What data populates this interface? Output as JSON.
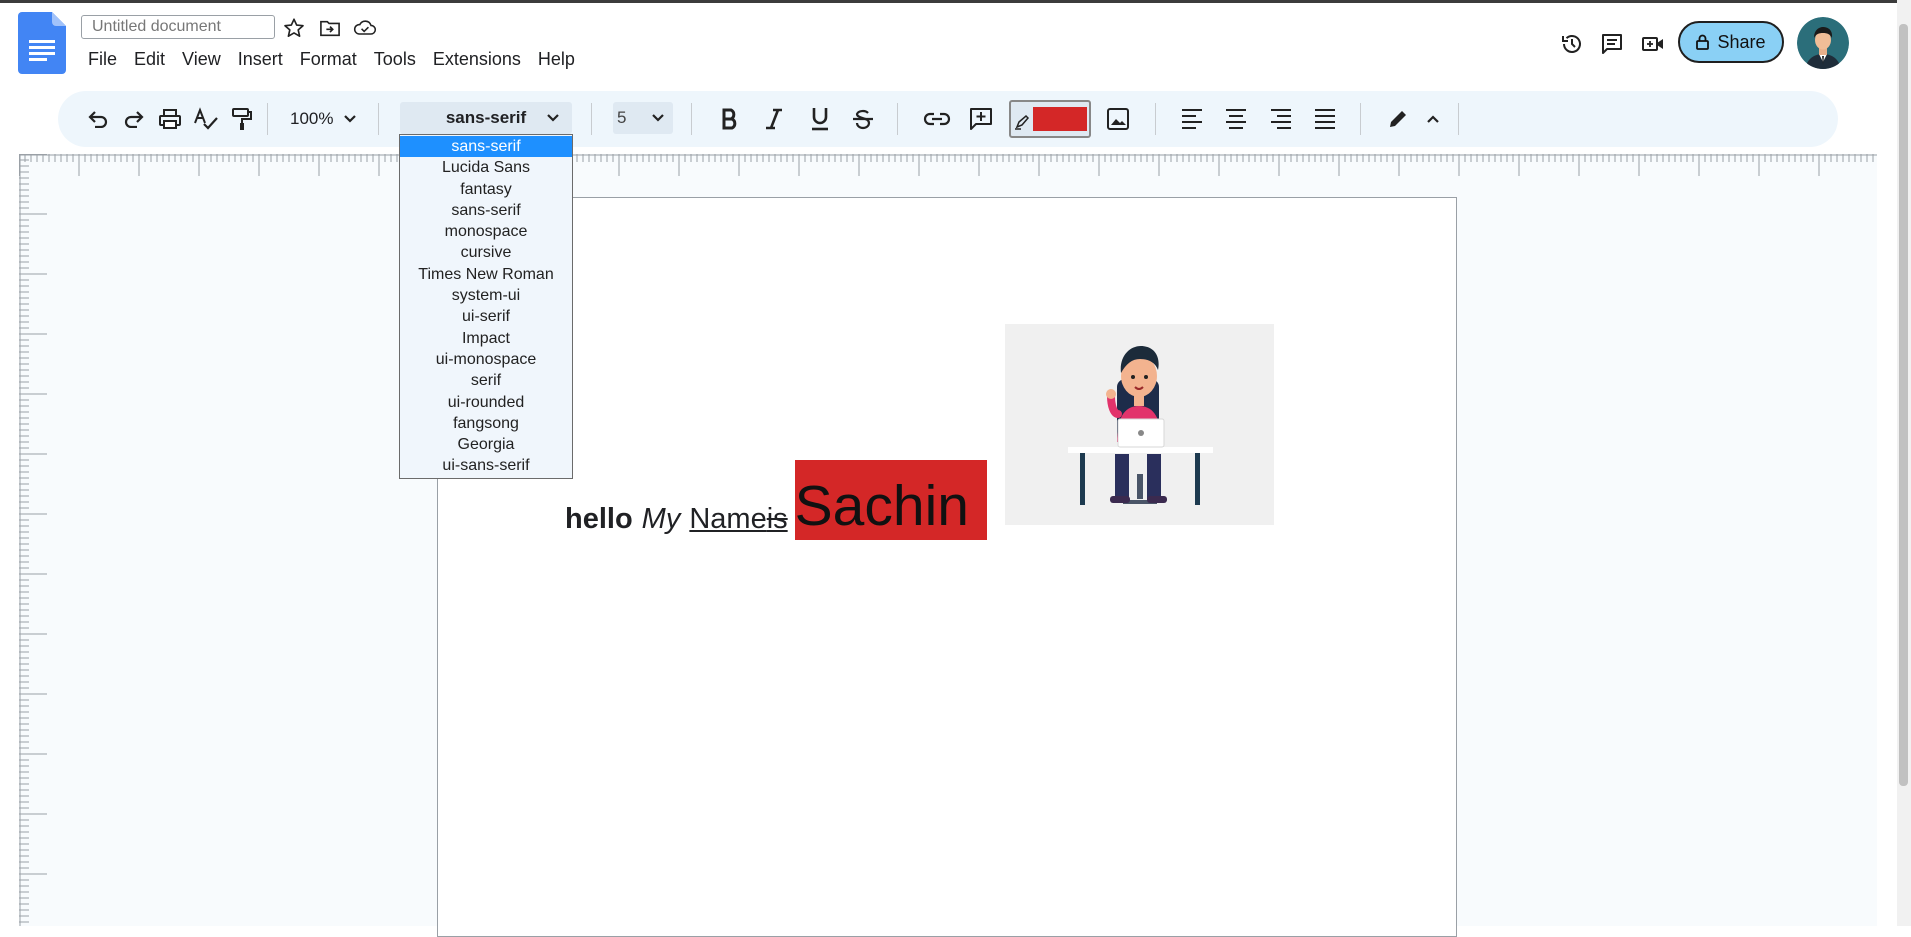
{
  "header": {
    "title_placeholder": "Untitled document",
    "menu": [
      "File",
      "Edit",
      "View",
      "Insert",
      "Format",
      "Tools",
      "Extensions",
      "Help"
    ],
    "share_label": "Share"
  },
  "toolbar": {
    "zoom": "100%",
    "font_family": "sans-serif",
    "font_size": "5",
    "text_color": "#d42727"
  },
  "font_dropdown": {
    "options": [
      "sans-serif",
      "Lucida Sans",
      "fantasy",
      "sans-serif",
      "monospace",
      "cursive",
      "Times New Roman",
      "system-ui",
      "ui-serif",
      "Impact",
      "ui-monospace",
      "serif",
      "ui-rounded",
      "fangsong",
      "Georgia",
      "ui-sans-serif"
    ],
    "selected": "sans-serif"
  },
  "document": {
    "words": [
      "hello",
      "My",
      "Name",
      "is",
      "Sachin"
    ]
  },
  "colors": {
    "accent": "#8ad0f5",
    "toolbar_bg": "#eef6fc",
    "highlight": "#d42727",
    "docs_blue": "#4285f4"
  }
}
